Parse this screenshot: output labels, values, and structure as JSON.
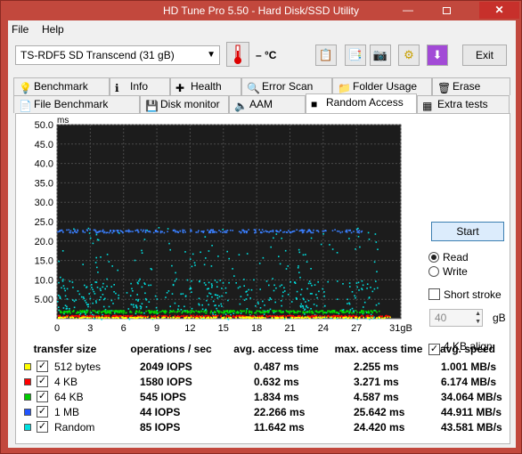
{
  "window": {
    "title": "HD Tune Pro 5.50 - Hard Disk/SSD Utility"
  },
  "menu": {
    "file": "File",
    "help": "Help"
  },
  "drive": {
    "selected": "TS-RDF5 SD  Transcend (31 gB)"
  },
  "temperature": {
    "value": "– °C"
  },
  "toolbar": {
    "exit_label": "Exit"
  },
  "tabs_row1": [
    {
      "label": "Benchmark",
      "icon": "bulb-icon"
    },
    {
      "label": "Info",
      "icon": "info-icon"
    },
    {
      "label": "Health",
      "icon": "health-cross-icon"
    },
    {
      "label": "Error Scan",
      "icon": "magnifier-icon"
    },
    {
      "label": "Folder Usage",
      "icon": "folder-icon"
    },
    {
      "label": "Erase",
      "icon": "trash-icon"
    }
  ],
  "tabs_row2": [
    {
      "label": "File Benchmark",
      "icon": "file-icon"
    },
    {
      "label": "Disk monitor",
      "icon": "disk-icon"
    },
    {
      "label": "AAM",
      "icon": "speaker-icon"
    },
    {
      "label": "Random Access",
      "icon": "random-icon",
      "selected": true
    },
    {
      "label": "Extra tests",
      "icon": "tests-icon"
    }
  ],
  "controls": {
    "start_label": "Start",
    "read_label": "Read",
    "write_label": "Write",
    "short_stroke_label": "Short stroke",
    "short_stroke_value": "40",
    "gb_unit": "gB",
    "kb_align_label": "4 KB align"
  },
  "chart_data": {
    "type": "scatter",
    "y_unit": "ms",
    "ylim": [
      0,
      50
    ],
    "y_ticks": [
      "50.0",
      "45.0",
      "40.0",
      "35.0",
      "30.0",
      "25.0",
      "20.0",
      "15.0",
      "10.0",
      "5.00"
    ],
    "xlim": [
      0,
      31
    ],
    "x_ticks": [
      "0",
      "3",
      "6",
      "9",
      "12",
      "15",
      "18",
      "21",
      "24",
      "27",
      "31gB"
    ],
    "grid": true,
    "series": [
      {
        "name": "512 bytes",
        "color": "#ffff00",
        "avg_ms": 0.487
      },
      {
        "name": "4 KB",
        "color": "#ff0000",
        "avg_ms": 0.632
      },
      {
        "name": "64 KB",
        "color": "#00dd00",
        "avg_ms": 1.834
      },
      {
        "name": "1 MB",
        "color": "#3a7fff",
        "avg_ms": 22.266
      },
      {
        "name": "Random",
        "color": "#00e0e0",
        "avg_ms": 11.642
      }
    ]
  },
  "results": {
    "headers": [
      "transfer size",
      "operations / sec",
      "avg. access time",
      "max. access time",
      "avg. speed"
    ],
    "rows": [
      {
        "color": "#ffff00",
        "size": "512 bytes",
        "ops": "2049 IOPS",
        "avg": "0.487 ms",
        "max": "2.255 ms",
        "speed": "1.001 MB/s"
      },
      {
        "color": "#ff0000",
        "size": "4 KB",
        "ops": "1580 IOPS",
        "avg": "0.632 ms",
        "max": "3.271 ms",
        "speed": "6.174 MB/s"
      },
      {
        "color": "#00cc00",
        "size": "64 KB",
        "ops": "545 IOPS",
        "avg": "1.834 ms",
        "max": "4.587 ms",
        "speed": "34.064 MB/s"
      },
      {
        "color": "#2255ff",
        "size": "1 MB",
        "ops": "44 IOPS",
        "avg": "22.266 ms",
        "max": "25.642 ms",
        "speed": "44.911 MB/s"
      },
      {
        "color": "#00e0e0",
        "size": "Random",
        "ops": "85 IOPS",
        "avg": "11.642 ms",
        "max": "24.420 ms",
        "speed": "43.581 MB/s"
      }
    ]
  }
}
